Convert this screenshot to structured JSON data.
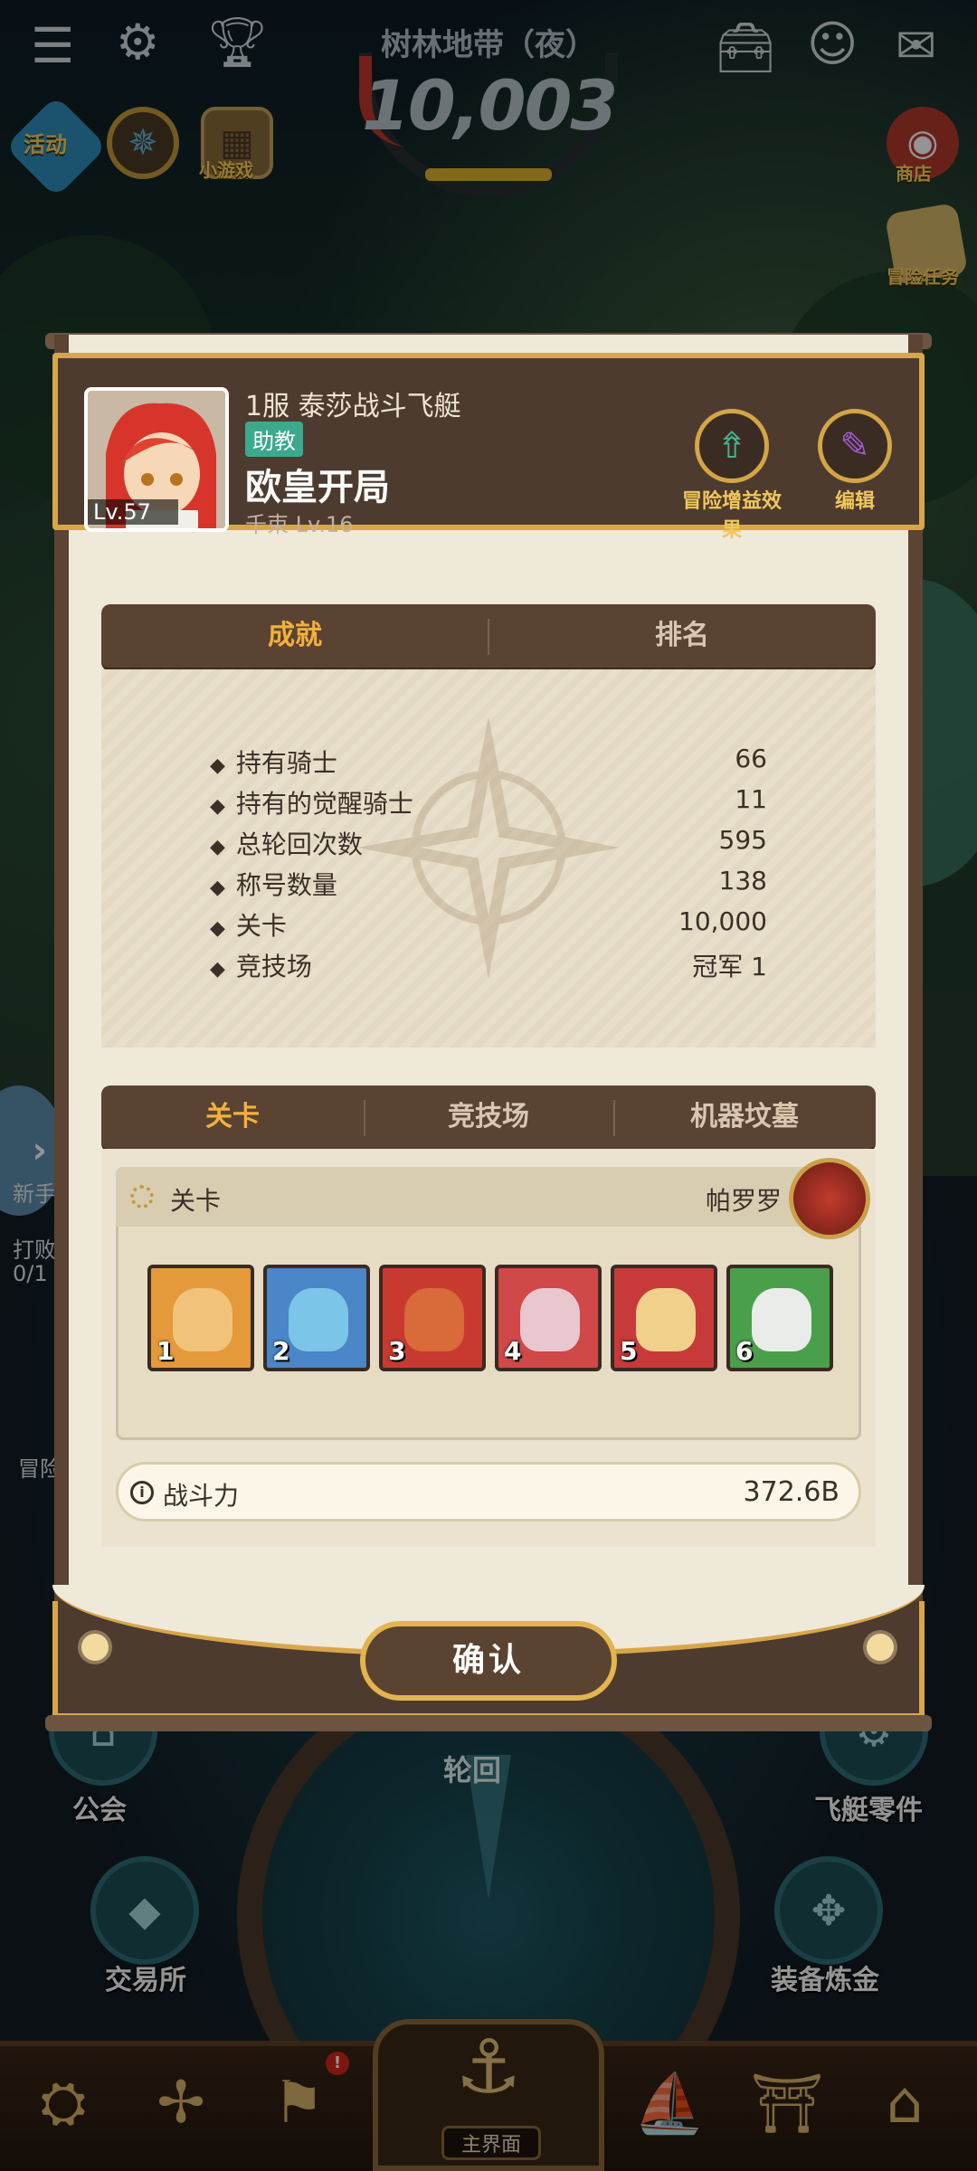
{
  "hud": {
    "zone_title": "树林地带（夜）",
    "score": "10,003",
    "left_icons": [
      {
        "label": "活动",
        "icon": "event-icon"
      },
      {
        "label": "",
        "icon": "wheel-icon"
      },
      {
        "label": "小游戏",
        "icon": "grid-icon"
      }
    ],
    "right_icons": [
      {
        "label": "商店",
        "icon": "shop-icon"
      },
      {
        "label": "冒险任务",
        "icon": "quest-icon"
      }
    ]
  },
  "profile": {
    "level": "Lv.57",
    "server_line": "1服 泰莎战斗飞艇",
    "role_badge": "助教",
    "name": "欧皇开局",
    "pet": "千束 Lv.16",
    "buttons": [
      {
        "label": "冒险增益效果",
        "icon": "buff-icon"
      },
      {
        "label": "编辑",
        "icon": "edit-icon"
      }
    ]
  },
  "tabs_top": [
    {
      "label": "成就",
      "active": true
    },
    {
      "label": "排名",
      "active": false
    }
  ],
  "achievements": [
    {
      "label": "持有骑士",
      "value": "66"
    },
    {
      "label": "持有的觉醒骑士",
      "value": "11"
    },
    {
      "label": "总轮回次数",
      "value": "595"
    },
    {
      "label": "称号数量",
      "value": "138"
    },
    {
      "label": "关卡",
      "value": "10,000"
    },
    {
      "label": "竞技场",
      "value": "冠军 1"
    }
  ],
  "tabs_bottom": [
    {
      "label": "关卡",
      "active": true
    },
    {
      "label": "竞技场",
      "active": false
    },
    {
      "label": "机器坟墓",
      "active": false
    }
  ],
  "stage": {
    "title": "关卡",
    "boss": "帕罗罗",
    "heroes": [
      {
        "slot": "1",
        "bg": "#e49a3a",
        "face": "#f1c27a"
      },
      {
        "slot": "2",
        "bg": "#4a86c8",
        "face": "#7bc5e8"
      },
      {
        "slot": "3",
        "bg": "#c83a30",
        "face": "#d96a3a"
      },
      {
        "slot": "4",
        "bg": "#d04848",
        "face": "#e9c7cf"
      },
      {
        "slot": "5",
        "bg": "#c83a3a",
        "face": "#f0d08a"
      },
      {
        "slot": "6",
        "bg": "#4aa04a",
        "face": "#e9ece8"
      }
    ],
    "power_label": "战斗力",
    "power_value": "372.6B"
  },
  "confirm_label": "确认",
  "background": {
    "center_label": "轮回",
    "left_labels": [
      "公会",
      "交易所"
    ],
    "right_labels": [
      "飞艇零件",
      "装备炼金"
    ],
    "peek_left": [
      "新手",
      "打败",
      "0/1",
      "冒险"
    ],
    "nav_center": "主界面"
  },
  "colors": {
    "panel_brown": "#4d3b2f",
    "gold_border": "#d8a64a",
    "active_tab": "#f2b13d",
    "role_badge": "#3aa98d"
  }
}
